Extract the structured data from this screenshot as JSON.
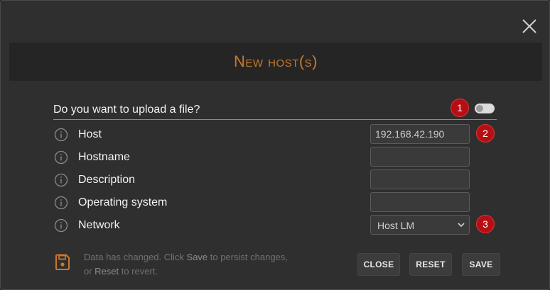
{
  "dialog": {
    "title": "New host(s)",
    "upload_question": "Do you want to upload a file?",
    "upload_toggle_on": false
  },
  "badges": [
    "1",
    "2",
    "3"
  ],
  "fields": [
    {
      "label": "Host",
      "value": "192.168.42.190",
      "type": "text"
    },
    {
      "label": "Hostname",
      "value": "",
      "type": "text"
    },
    {
      "label": "Description",
      "value": "",
      "type": "text"
    },
    {
      "label": "Operating system",
      "value": "",
      "type": "text"
    },
    {
      "label": "Network",
      "value": "Host LM",
      "type": "select"
    }
  ],
  "footer": {
    "msg_part1": "Data has changed. Click ",
    "msg_save": "Save",
    "msg_part2": " to persist changes, or ",
    "msg_reset": "Reset",
    "msg_part3": " to revert.",
    "buttons": {
      "close": "CLOSE",
      "reset": "RESET",
      "save": "SAVE"
    }
  },
  "colors": {
    "accent": "#c8782c",
    "badge": "#b50f13",
    "background": "#2f2f2f"
  },
  "icons": [
    "close-icon",
    "info-icon",
    "chevron-down-icon",
    "floppy-disk-icon"
  ]
}
